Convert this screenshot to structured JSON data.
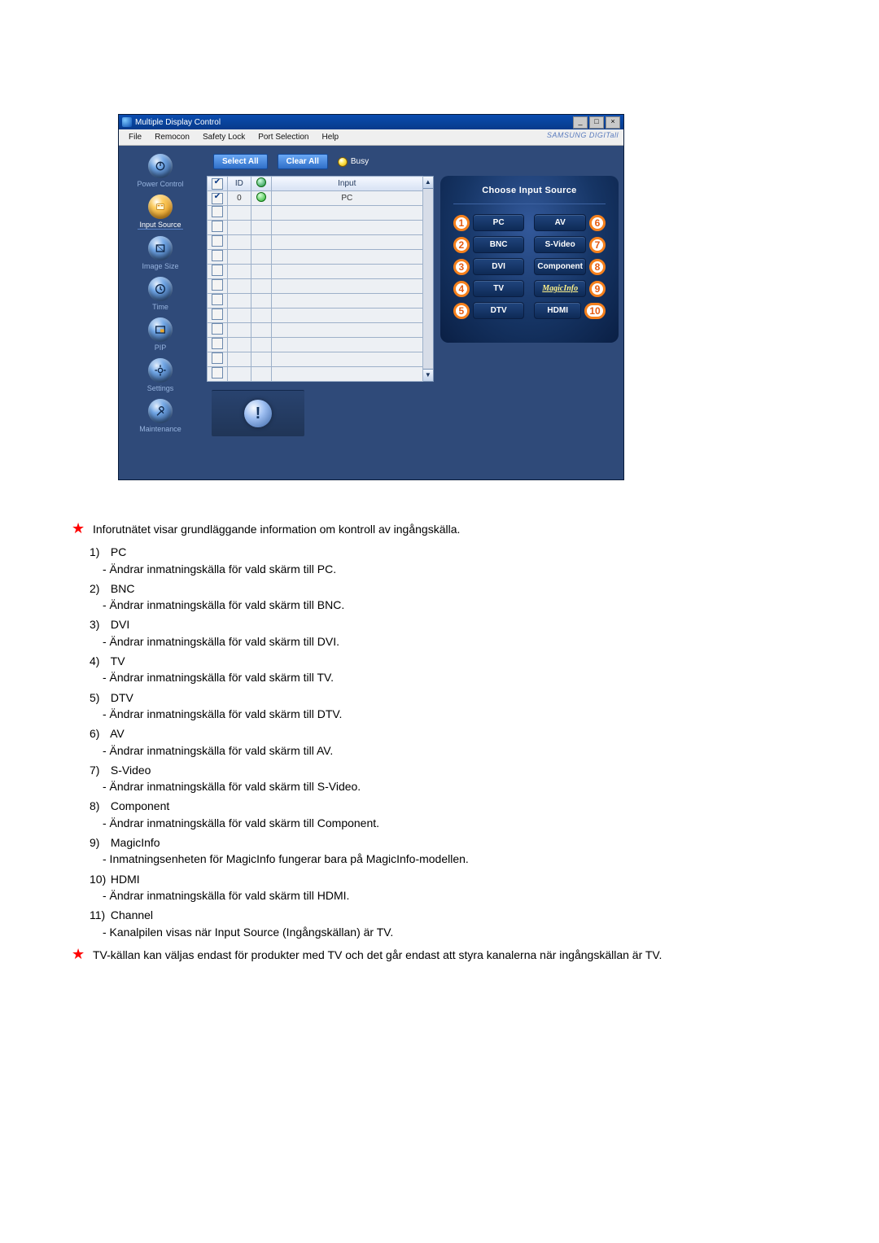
{
  "app": {
    "title": "Multiple Display Control",
    "brand": "SAMSUNG DIGITall",
    "menu": [
      "File",
      "Remocon",
      "Safety Lock",
      "Port Selection",
      "Help"
    ],
    "window_buttons": [
      "_",
      "□",
      "×"
    ],
    "toolbar": {
      "select_all": "Select All",
      "clear_all": "Clear All",
      "busy": "Busy"
    },
    "sidebar": [
      {
        "label": "Power Control",
        "icon": "power-icon",
        "active": false
      },
      {
        "label": "Input Source",
        "icon": "input-source-icon",
        "active": true
      },
      {
        "label": "Image Size",
        "icon": "image-size-icon",
        "active": false
      },
      {
        "label": "Time",
        "icon": "time-icon",
        "active": false
      },
      {
        "label": "PIP",
        "icon": "pip-icon",
        "active": false
      },
      {
        "label": "Settings",
        "icon": "settings-icon",
        "active": false
      },
      {
        "label": "Maintenance",
        "icon": "maintenance-icon",
        "active": false
      }
    ],
    "table": {
      "headers": {
        "chk": "☑",
        "id": "ID",
        "status": "",
        "input": "Input"
      },
      "rows": [
        {
          "checked": true,
          "id": "0",
          "status": "green",
          "input": "PC"
        },
        {
          "checked": false,
          "id": "",
          "status": "",
          "input": ""
        },
        {
          "checked": false,
          "id": "",
          "status": "",
          "input": ""
        },
        {
          "checked": false,
          "id": "",
          "status": "",
          "input": ""
        },
        {
          "checked": false,
          "id": "",
          "status": "",
          "input": ""
        },
        {
          "checked": false,
          "id": "",
          "status": "",
          "input": ""
        },
        {
          "checked": false,
          "id": "",
          "status": "",
          "input": ""
        },
        {
          "checked": false,
          "id": "",
          "status": "",
          "input": ""
        },
        {
          "checked": false,
          "id": "",
          "status": "",
          "input": ""
        },
        {
          "checked": false,
          "id": "",
          "status": "",
          "input": ""
        },
        {
          "checked": false,
          "id": "",
          "status": "",
          "input": ""
        },
        {
          "checked": false,
          "id": "",
          "status": "",
          "input": ""
        },
        {
          "checked": false,
          "id": "",
          "status": "",
          "input": ""
        }
      ]
    },
    "source_panel": {
      "title": "Choose Input Source",
      "left": [
        {
          "n": "1",
          "label": "PC"
        },
        {
          "n": "2",
          "label": "BNC"
        },
        {
          "n": "3",
          "label": "DVI"
        },
        {
          "n": "4",
          "label": "TV"
        },
        {
          "n": "5",
          "label": "DTV"
        }
      ],
      "right": [
        {
          "n": "6",
          "label": "AV"
        },
        {
          "n": "7",
          "label": "S-Video"
        },
        {
          "n": "8",
          "label": "Component"
        },
        {
          "n": "9",
          "label": "MagicInfo",
          "magic": true
        },
        {
          "n": "10",
          "label": "HDMI"
        }
      ]
    },
    "alert_icon": "!"
  },
  "doc": {
    "intro": "Inforutnätet visar grundläggande information om kontroll av ingångskälla.",
    "items": [
      {
        "n": "1)",
        "h": "PC",
        "d": "- Ändrar inmatningskälla för vald skärm till PC."
      },
      {
        "n": "2)",
        "h": "BNC",
        "d": "- Ändrar inmatningskälla för vald skärm till BNC."
      },
      {
        "n": "3)",
        "h": "DVI",
        "d": "- Ändrar inmatningskälla för vald skärm till DVI."
      },
      {
        "n": "4)",
        "h": "TV",
        "d": "- Ändrar inmatningskälla för vald skärm till TV."
      },
      {
        "n": "5)",
        "h": "DTV",
        "d": "- Ändrar inmatningskälla för vald skärm till DTV."
      },
      {
        "n": "6)",
        "h": "AV",
        "d": "- Ändrar inmatningskälla för vald skärm till AV."
      },
      {
        "n": "7)",
        "h": "S-Video",
        "d": "- Ändrar inmatningskälla för vald skärm till S-Video."
      },
      {
        "n": "8)",
        "h": "Component",
        "d": "- Ändrar inmatningskälla för vald skärm till Component."
      },
      {
        "n": "9)",
        "h": "MagicInfo",
        "d": "- Inmatningsenheten för MagicInfo fungerar bara på MagicInfo-modellen."
      },
      {
        "n": "10)",
        "h": "HDMI",
        "d": "- Ändrar inmatningskälla för vald skärm till HDMI."
      },
      {
        "n": "11)",
        "h": "Channel",
        "d": "- Kanalpilen visas när Input Source (Ingångskällan) är TV."
      }
    ],
    "footer_note": "TV-källan kan väljas endast för produkter med TV och det går endast att styra kanalerna när ingångskällan är TV."
  }
}
